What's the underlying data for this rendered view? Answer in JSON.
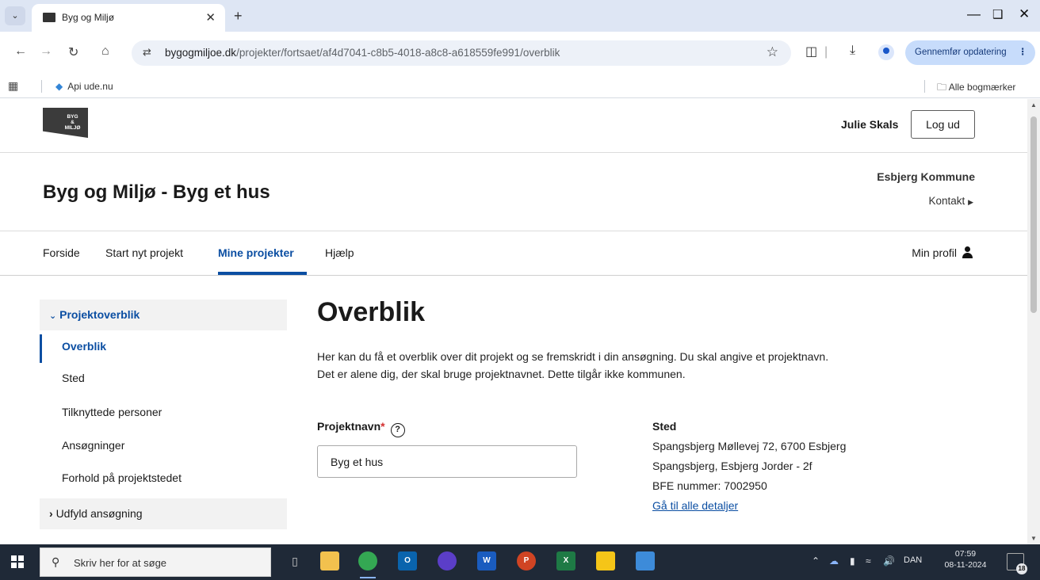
{
  "browser": {
    "tab_title": "Byg og Miljø",
    "url_host": "bygogmiljoe.dk",
    "url_path": "/projekter/fortsaet/af4d7041-c8b5-4018-a8c8-a618559fe991/overblik",
    "update_button": "Gennemfør opdatering",
    "bookmark_1": "Api ude.nu",
    "bookmarks_folder": "Alle bogmærker"
  },
  "header": {
    "logo_lines": [
      "BYG",
      "&",
      "MILJØ"
    ],
    "user_name": "Julie Skals",
    "logout_label": "Log ud"
  },
  "site": {
    "title": "Byg og Miljø - Byg et hus",
    "municipality": "Esbjerg Kommune",
    "contact": "Kontakt"
  },
  "mainnav": {
    "items": [
      {
        "label": "Forside"
      },
      {
        "label": "Start nyt projekt"
      },
      {
        "label": "Mine projekter"
      },
      {
        "label": "Hjælp"
      }
    ],
    "profile_label": "Min profil"
  },
  "sidebar": {
    "group_open": "Projektoverblik",
    "items": [
      {
        "label": "Overblik"
      },
      {
        "label": "Sted"
      },
      {
        "label": "Tilknyttede personer"
      },
      {
        "label": "Ansøgninger"
      },
      {
        "label": "Forhold på projektstedet"
      }
    ],
    "group_closed": "Udfyld ansøgning"
  },
  "main": {
    "heading": "Overblik",
    "intro": "Her kan du få et overblik over dit projekt og se fremskridt i din ansøgning. Du skal angive et projektnavn. Det er alene dig, der skal bruge projektnavnet. Dette tilgår ikke kommunen.",
    "project_name_label": "Projektnavn",
    "project_name_required": "*",
    "project_name_value": "Byg et hus",
    "place_title": "Sted",
    "place_address": "Spangsbjerg Møllevej 72, 6700 Esbjerg",
    "place_cadastre": "Spangsbjerg, Esbjerg Jorder - 2f",
    "place_bfe": "BFE nummer: 7002950",
    "place_link": "Gå til alle detaljer"
  },
  "taskbar": {
    "search_placeholder": "Skriv her for at søge",
    "language": "DAN",
    "time": "07:59",
    "date": "08-11-2024",
    "notification_count": "18"
  },
  "colors": {
    "brand_blue": "#0b4ea2",
    "required_red": "#d32f2f",
    "tabbar_bg": "#dee6f4",
    "taskbar_bg": "#1f2937"
  },
  "icons": [
    "tab-search-icon",
    "close-icon",
    "plus-icon",
    "minimize-icon",
    "restore-icon",
    "back-icon",
    "forward-icon",
    "reload-icon",
    "home-icon",
    "site-settings-icon",
    "bookmark-star-icon",
    "extensions-icon",
    "download-icon",
    "profile-icon",
    "more-icon",
    "apps-grid-icon",
    "folder-icon",
    "chevron-right-icon",
    "chevron-down-icon",
    "person-icon",
    "help-icon",
    "windows-start-icon",
    "search-icon"
  ]
}
